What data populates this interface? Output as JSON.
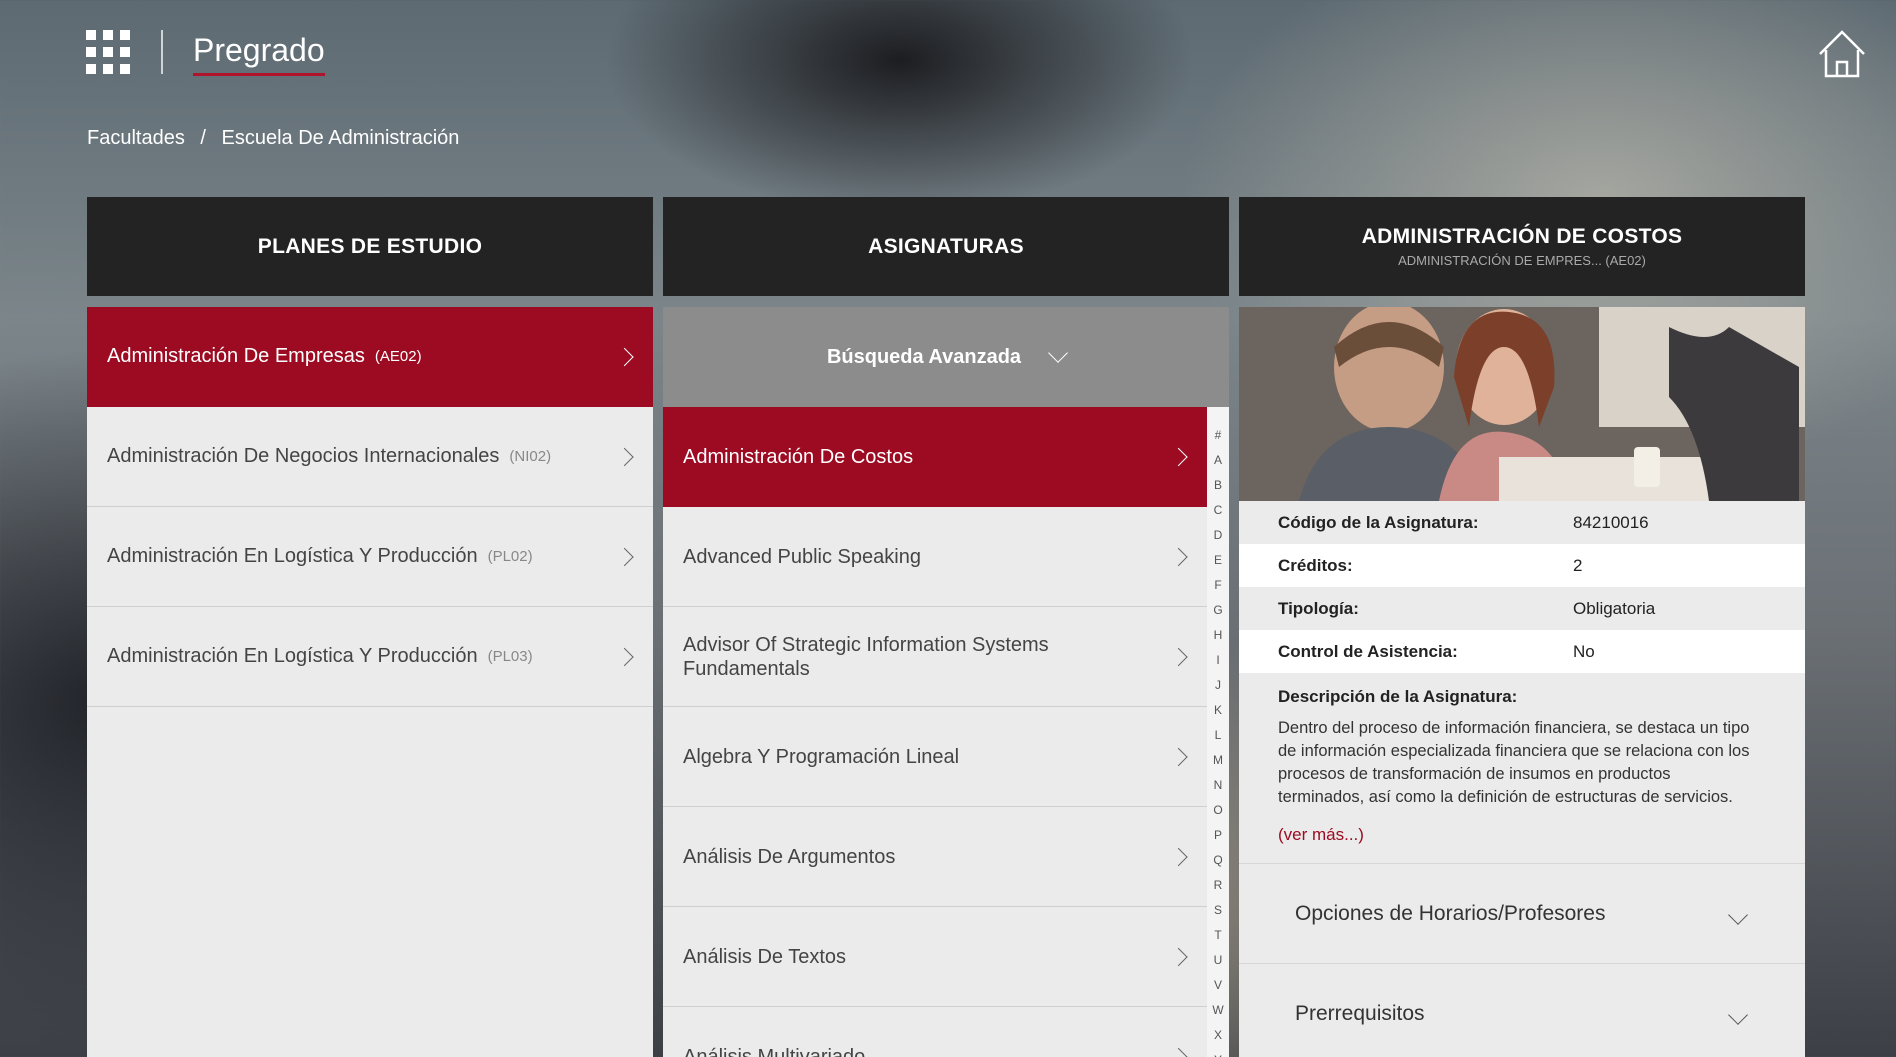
{
  "header": {
    "title": "Pregrado"
  },
  "breadcrumb": {
    "items": [
      "Facultades",
      "/",
      "Escuela De Administración"
    ]
  },
  "plans": {
    "heading": "PLANES DE ESTUDIO",
    "items": [
      {
        "label": "Administración De Empresas",
        "code": "(AE02)"
      },
      {
        "label": "Administración De Negocios Internacionales",
        "code": "(NI02)"
      },
      {
        "label": "Administración En Logística Y Producción",
        "code": "(PL02)"
      },
      {
        "label": "Administración En Logística Y Producción",
        "code": "(PL03)"
      }
    ]
  },
  "subjects": {
    "heading": "ASIGNATURAS",
    "search_label": "Búsqueda Avanzada",
    "items": [
      "Administración De Costos",
      "Advanced Public Speaking",
      "Advisor Of Strategic Information Systems Fundamentals",
      "Algebra Y Programación Lineal",
      "Análisis De Argumentos",
      "Análisis De Textos",
      "Análisis Multivariado"
    ],
    "alphabet": [
      "#",
      "A",
      "B",
      "C",
      "D",
      "E",
      "F",
      "G",
      "H",
      "I",
      "J",
      "K",
      "L",
      "M",
      "N",
      "O",
      "P",
      "Q",
      "R",
      "S",
      "T",
      "U",
      "V",
      "W",
      "X",
      "Y"
    ]
  },
  "detail": {
    "title": "ADMINISTRACIÓN DE COSTOS",
    "subtitle": "ADMINISTRACIÓN DE EMPRES... (AE02)",
    "fields": [
      {
        "key": "Código de la Asignatura:",
        "value": "84210016"
      },
      {
        "key": "Créditos:",
        "value": "2"
      },
      {
        "key": "Tipología:",
        "value": "Obligatoria"
      },
      {
        "key": "Control de Asistencia:",
        "value": "No"
      }
    ],
    "description_title": "Descripción de la Asignatura:",
    "description": "Dentro del proceso de información financiera, se destaca un tipo de información especializada financiera que se relaciona con los procesos de transformación de insumos en productos terminados, así como la definición de estructuras de servicios. Esta información corresponde al tema de los COSTOS. La",
    "more_label": "(ver más...)",
    "accordions": [
      "Opciones de Horarios/Profesores",
      "Prerrequisitos"
    ]
  },
  "colors": {
    "accent": "#9c0b22",
    "header_bg": "#232323",
    "list_bg": "#ebebeb"
  }
}
